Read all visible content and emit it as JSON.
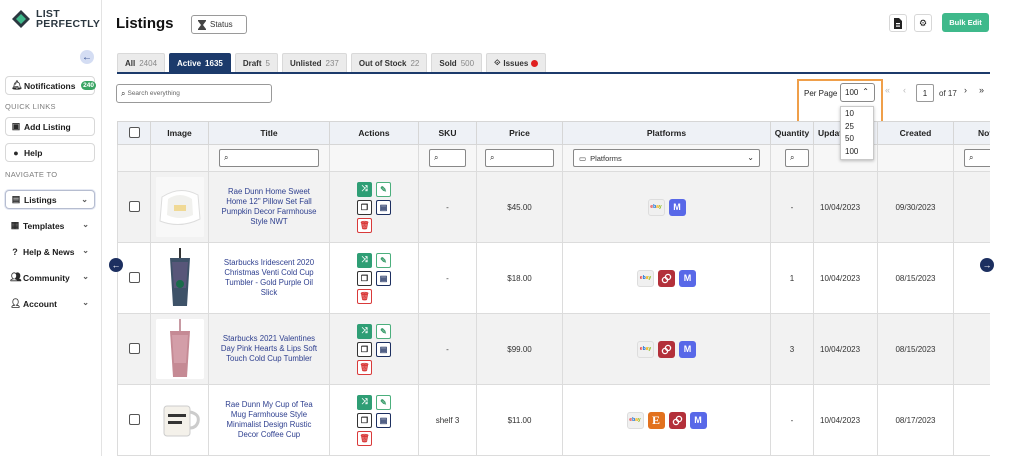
{
  "brand": {
    "line1": "LIST",
    "line2": "PERFECTLY"
  },
  "sidebar": {
    "notifications": {
      "label": "Notifications",
      "count": "240"
    },
    "quick_links_heading": "QUICK LINKS",
    "add_listing": "Add Listing",
    "help": "Help",
    "navigate_heading": "NAVIGATE TO",
    "nav": [
      "Listings",
      "Templates",
      "Help & News",
      "Community",
      "Account"
    ]
  },
  "header": {
    "title": "Listings",
    "status_label": "Status",
    "bulk_edit": "Bulk Edit"
  },
  "tabs": [
    {
      "label": "All",
      "count": "2404"
    },
    {
      "label": "Active",
      "count": "1635"
    },
    {
      "label": "Draft",
      "count": "5"
    },
    {
      "label": "Unlisted",
      "count": "237"
    },
    {
      "label": "Out of Stock",
      "count": "22"
    },
    {
      "label": "Sold",
      "count": "500"
    },
    {
      "label": "Issues",
      "count": ""
    }
  ],
  "search": {
    "placeholder": "Search everything"
  },
  "per_page": {
    "label": "Per Page",
    "selected": "100",
    "options": [
      "10",
      "25",
      "50",
      "100"
    ]
  },
  "pagination": {
    "first": "«",
    "prev": "‹",
    "current": "1",
    "of_label": "of 17",
    "next": "›",
    "last": "»"
  },
  "columns": [
    "Image",
    "Title",
    "Actions",
    "SKU",
    "Price",
    "Platforms",
    "Quantity",
    "Updat",
    "Created",
    "Not"
  ],
  "filters": {
    "platforms_placeholder": "Platforms"
  },
  "rows": [
    {
      "title": "Rae Dunn Home Sweet Home 12\" Pillow Set Fall Pumpkin Decor Farmhouse Style NWT",
      "sku": "-",
      "price": "$45.00",
      "platforms": [
        "ebay",
        "mercari"
      ],
      "quantity": "-",
      "updated": "10/04/2023",
      "created": "09/30/2023",
      "notes": "-"
    },
    {
      "title": "Starbucks Iridescent 2020 Christmas Venti Cold Cup Tumbler - Gold Purple Oil Slick",
      "sku": "-",
      "price": "$18.00",
      "platforms": [
        "ebay",
        "poshmark",
        "mercari"
      ],
      "quantity": "1",
      "updated": "10/04/2023",
      "created": "08/15/2023",
      "notes": "-"
    },
    {
      "title": "Starbucks 2021 Valentines Day Pink Hearts & Lips Soft Touch Cold Cup Tumbler",
      "sku": "-",
      "price": "$99.00",
      "platforms": [
        "ebay",
        "poshmark",
        "mercari"
      ],
      "quantity": "3",
      "updated": "10/04/2023",
      "created": "08/15/2023",
      "notes": "-"
    },
    {
      "title": "Rae Dunn My Cup of Tea Mug Farmhouse Style Minimalist Design Rustic Decor Coffee Cup",
      "sku": "shelf 3",
      "price": "$11.00",
      "platforms": [
        "ebay",
        "etsy",
        "poshmark",
        "mercari"
      ],
      "quantity": "-",
      "updated": "10/04/2023",
      "created": "08/17/2023",
      "notes": "-"
    }
  ],
  "icons": {
    "ebay": "ebay",
    "etsy": "E",
    "mercari": "M",
    "poshmark": "P"
  },
  "colors": {
    "primary": "#1c3a6b",
    "accent": "#3fb98b",
    "highlight": "#ef9f4a",
    "alert": "#e02020"
  }
}
